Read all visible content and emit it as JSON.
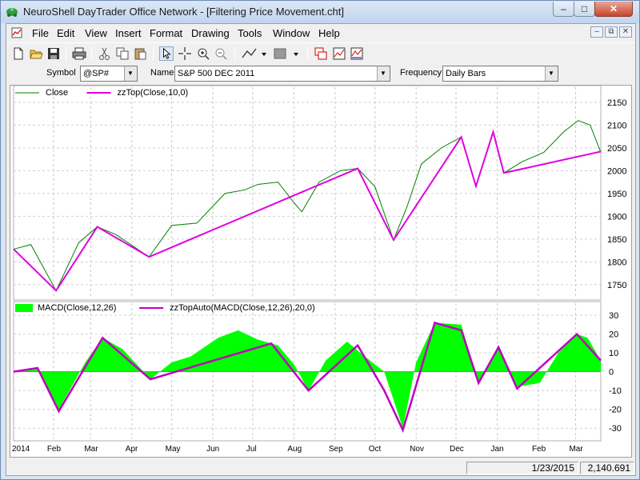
{
  "window": {
    "title": "NeuroShell DayTrader Office Network - [Filtering Price Movement.cht]"
  },
  "title_buttons": {
    "minimize": "–",
    "maximize": "□",
    "close": "✕"
  },
  "menu": {
    "items": [
      "File",
      "Edit",
      "View",
      "Insert",
      "Format",
      "Drawing",
      "Tools",
      "Window",
      "Help"
    ],
    "mdi_buttons": [
      "–",
      "⧉",
      "✕"
    ]
  },
  "toolbar": {
    "icons": [
      "new-icon",
      "open-icon",
      "save-icon",
      "print-icon",
      "cut-icon",
      "copy-icon",
      "paste-icon",
      "pointer-icon",
      "crosshair-icon",
      "zoom-in-icon",
      "zoom-out-icon",
      "line-tool-icon",
      "fill-pattern-icon",
      "chart-window-icon",
      "chart-properties-icon",
      "chart-insert-icon"
    ]
  },
  "symbolbar": {
    "symbol_label": "Symbol",
    "symbol_value": "@SP#",
    "name_label": "Name",
    "name_value": "S&P 500 DEC 2011",
    "frequency_label": "Frequency",
    "frequency_value": "Daily Bars"
  },
  "chart_data": [
    {
      "type": "line",
      "legend": [
        "Close",
        "zzTop(Close,10,0)"
      ],
      "colors": {
        "Close": "#008000",
        "zzTop(Close,10,0)": "#e000e0"
      },
      "y_ticks": [
        "2150",
        "2100",
        "2050",
        "2000",
        "1950",
        "1900",
        "1850",
        "1800",
        "1750"
      ],
      "ylim": [
        1720,
        2155
      ],
      "x_ticks": [
        "2014",
        "Feb",
        "Mar",
        "Apr",
        "May",
        "Jun",
        "Jul",
        "Aug",
        "Sep",
        "Oct",
        "Nov",
        "Dec",
        "Jan",
        "Feb",
        "Mar"
      ],
      "grid": true,
      "series": [
        {
          "name": "zzTop(Close,10,0)",
          "x": [
            "2014-01-02",
            "2014-02-03",
            "2014-03-06",
            "2014-04-14",
            "2014-09-18",
            "2014-10-15",
            "2014-12-05",
            "2014-12-16",
            "2014-12-29",
            "2015-01-06",
            "2015-03-20"
          ],
          "values": [
            1828,
            1737,
            1877,
            1811,
            2005,
            1848,
            2074,
            1966,
            2085,
            1995,
            2042
          ]
        },
        {
          "name": "Close",
          "x": [
            "2014-01-02",
            "2014-01-15",
            "2014-02-03",
            "2014-02-20",
            "2014-03-06",
            "2014-03-20",
            "2014-04-14",
            "2014-05-01",
            "2014-05-20",
            "2014-06-10",
            "2014-06-25",
            "2014-07-05",
            "2014-07-20",
            "2014-08-01",
            "2014-08-07",
            "2014-08-20",
            "2014-09-05",
            "2014-09-18",
            "2014-10-01",
            "2014-10-15",
            "2014-10-25",
            "2014-11-05",
            "2014-11-20",
            "2014-12-05",
            "2014-12-16",
            "2014-12-29",
            "2015-01-06",
            "2015-01-20",
            "2015-02-05",
            "2015-02-20",
            "2015-03-03",
            "2015-03-12",
            "2015-03-20"
          ],
          "values": [
            1828,
            1838,
            1737,
            1842,
            1877,
            1860,
            1811,
            1880,
            1885,
            1950,
            1958,
            1970,
            1975,
            1930,
            1910,
            1975,
            2000,
            2005,
            1965,
            1848,
            1920,
            2015,
            2050,
            2074,
            1966,
            2085,
            1995,
            2020,
            2040,
            2085,
            2110,
            2100,
            2040
          ]
        }
      ]
    },
    {
      "type": "area",
      "legend": [
        "MACD(Close,12,26)",
        "zzTopAuto(MACD(Close,12,26),20,0)"
      ],
      "colors": {
        "MACD(Close,12,26)": "#00ff00",
        "zzTopAuto(MACD(Close,12,26),20,0)": "#c000c0"
      },
      "y_ticks": [
        "30",
        "20",
        "10",
        "0",
        "-10",
        "-20",
        "-30"
      ],
      "ylim": [
        -35,
        33
      ],
      "grid": true,
      "series": [
        {
          "name": "zzTopAuto(MACD(Close,12,26),20,0)",
          "x": [
            "2014-01-02",
            "2014-01-20",
            "2014-02-05",
            "2014-03-10",
            "2014-04-15",
            "2014-07-15",
            "2014-08-12",
            "2014-09-18",
            "2014-10-08",
            "2014-10-22",
            "2014-11-15",
            "2014-12-05",
            "2014-12-18",
            "2015-01-02",
            "2015-01-16",
            "2015-03-02",
            "2015-03-20"
          ],
          "values": [
            0,
            2,
            -21,
            18,
            -4,
            15,
            -10,
            14,
            -10,
            -31,
            26,
            22,
            -6,
            13,
            -9,
            20,
            6
          ]
        },
        {
          "name": "MACD(Close,12,26)",
          "x": [
            "2014-01-02",
            "2014-01-20",
            "2014-02-05",
            "2014-02-25",
            "2014-03-10",
            "2014-03-25",
            "2014-04-15",
            "2014-05-01",
            "2014-05-15",
            "2014-06-05",
            "2014-06-20",
            "2014-07-05",
            "2014-07-20",
            "2014-08-01",
            "2014-08-12",
            "2014-08-25",
            "2014-09-10",
            "2014-09-20",
            "2014-10-08",
            "2014-10-22",
            "2014-11-01",
            "2014-11-15",
            "2014-12-05",
            "2014-12-18",
            "2015-01-02",
            "2015-01-16",
            "2015-02-02",
            "2015-02-16",
            "2015-03-02",
            "2015-03-10",
            "2015-03-20"
          ],
          "values": [
            0,
            2,
            -20,
            5,
            18,
            12,
            -4,
            5,
            8,
            18,
            22,
            17,
            14,
            4,
            -10,
            6,
            16,
            10,
            0,
            -30,
            5,
            26,
            25,
            -6,
            13,
            -8,
            -6,
            10,
            20,
            18,
            6
          ]
        }
      ]
    }
  ],
  "status": {
    "date": "1/23/2015",
    "value": "2,140.691"
  }
}
